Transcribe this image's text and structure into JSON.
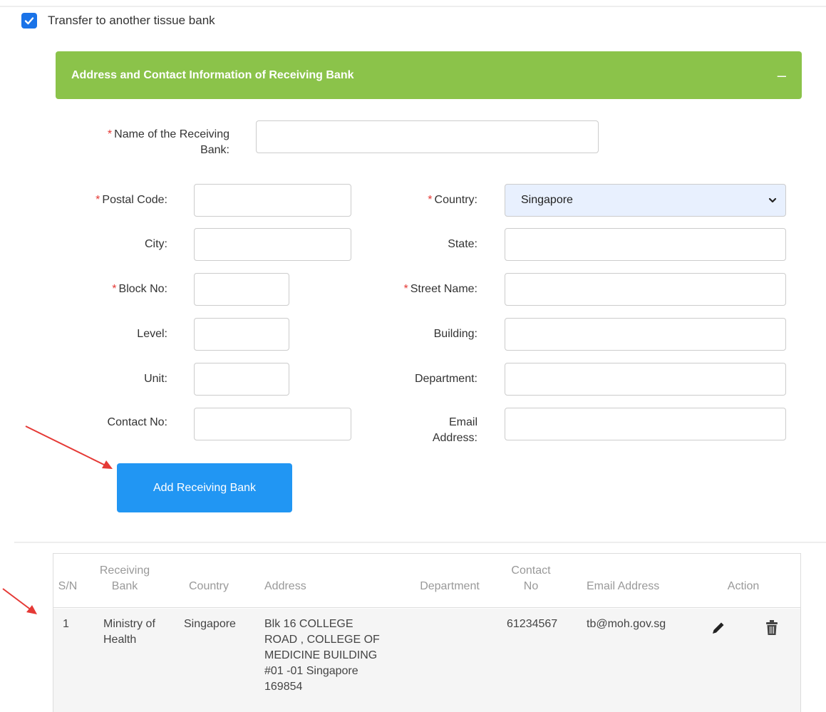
{
  "transfer": {
    "label": "Transfer to another tissue bank",
    "checked": true
  },
  "panel": {
    "title": "Address and Contact Information of Receiving Bank",
    "collapse_symbol": "–"
  },
  "form": {
    "required_mark": "*",
    "bank_name_label_line1": "Name of the Receiving",
    "bank_name_label_line2": "Bank:",
    "postal_code_label": "Postal Code:",
    "country_label": "Country:",
    "country_value": "Singapore",
    "city_label": "City:",
    "state_label": "State:",
    "block_no_label": "Block No:",
    "street_name_label": "Street Name:",
    "level_label": "Level:",
    "building_label": "Building:",
    "unit_label": "Unit:",
    "department_label": "Department:",
    "contact_no_label": "Contact No:",
    "email_label_line1": "Email",
    "email_label_line2": "Address:"
  },
  "add_button": {
    "label": "Add Receiving Bank"
  },
  "table": {
    "headers": {
      "sn": "S/N",
      "bank_line1": "Receiving",
      "bank_line2": "Bank",
      "country": "Country",
      "address": "Address",
      "department": "Department",
      "contact_line1": "Contact",
      "contact_line2": "No",
      "email": "Email Address",
      "action": "Action"
    },
    "rows": [
      {
        "sn": "1",
        "bank_line1": "Ministry of",
        "bank_line2": "Health",
        "country": "Singapore",
        "address_lines": [
          "Blk 16 COLLEGE",
          "ROAD , COLLEGE OF",
          "MEDICINE BUILDING",
          "#01 -01 Singapore",
          "169854"
        ],
        "department": "",
        "contact": "61234567",
        "email": "tb@moh.gov.sg"
      }
    ]
  },
  "colors": {
    "panel_header": "#8bc34a",
    "button": "#2196f3",
    "checkbox": "#1a73e8",
    "required": "#e53935",
    "arrow": "#e53935"
  },
  "icons": [
    "check-icon",
    "collapse-icon",
    "chevron-down-icon",
    "edit-pencil-icon",
    "trash-icon",
    "annotation-arrow"
  ]
}
